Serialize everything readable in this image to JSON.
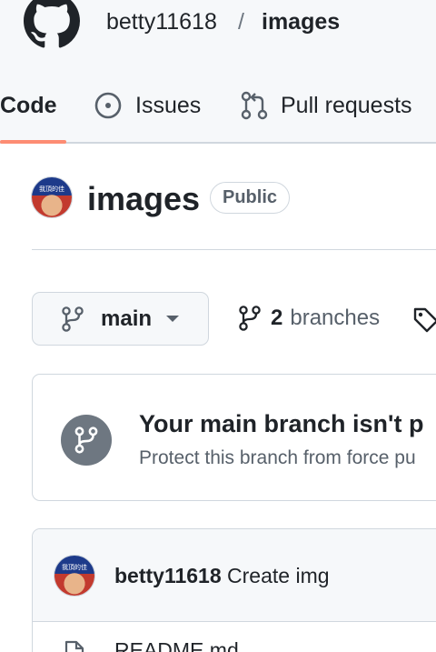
{
  "header": {
    "owner": "betty11618",
    "separator": "/",
    "repo": "images"
  },
  "tabs": [
    {
      "label": "Code",
      "active": true,
      "icon": "code-icon"
    },
    {
      "label": "Issues",
      "icon": "issue-circle-icon"
    },
    {
      "label": "Pull requests",
      "icon": "pull-request-icon"
    }
  ],
  "repo": {
    "title": "images",
    "visibility": "Public",
    "avatar_text": "我頂的佳"
  },
  "branch": {
    "current": "main",
    "count": "2",
    "branches_label": "branches"
  },
  "protect": {
    "title": "Your main branch isn't p",
    "description": "Protect this branch from force pu"
  },
  "commit": {
    "author": "betty11618",
    "message": "Create img"
  },
  "files": [
    {
      "name": "README.md",
      "icon": "file-icon"
    }
  ],
  "colors": {
    "active_tab_underline": "#fd8c73",
    "header_bg": "#f6f8fa",
    "border": "#d0d7de"
  }
}
